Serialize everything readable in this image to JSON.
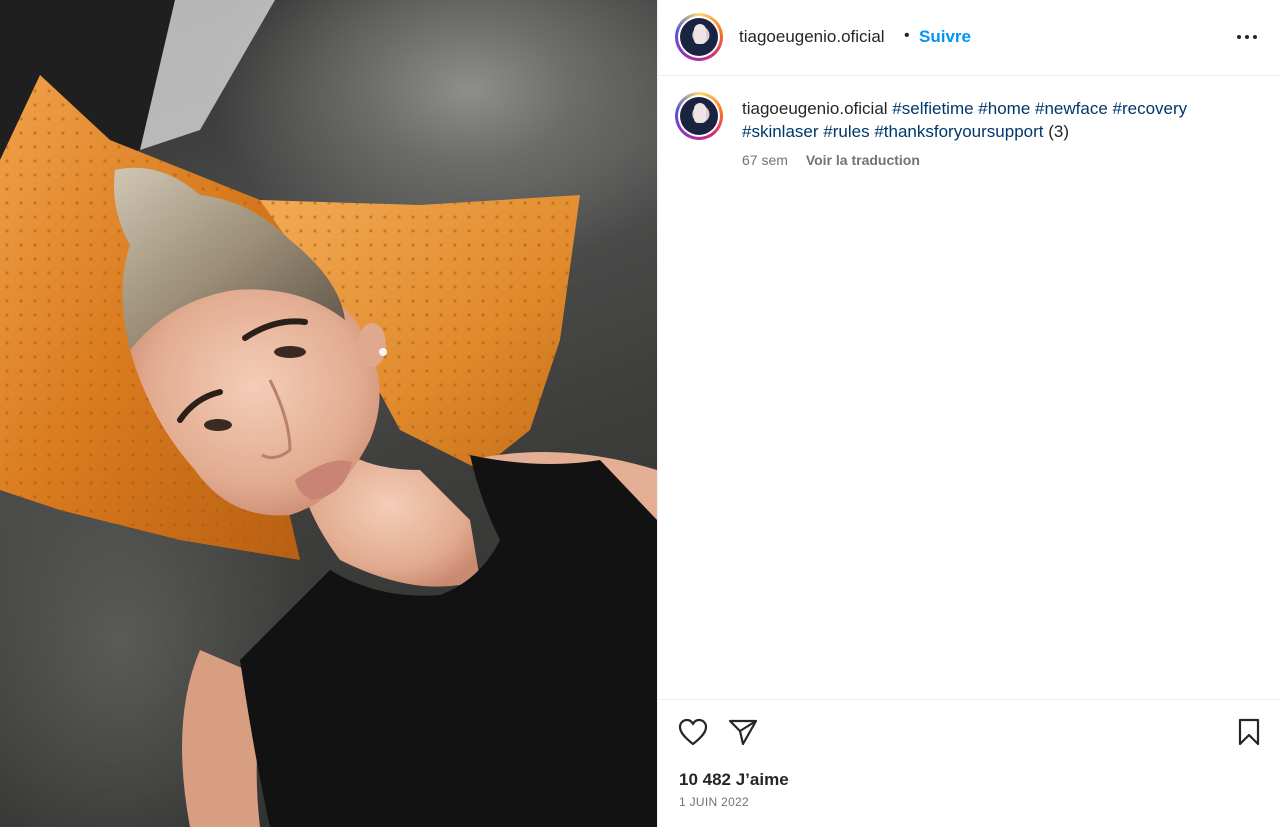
{
  "post": {
    "image_alt": "selfie",
    "header": {
      "username": "tiagoeugenio.oficial",
      "separator": "•",
      "follow_label": "Suivre",
      "more_icon": "more-horizontal-icon"
    },
    "caption": {
      "username": "tiagoeugenio.oficial",
      "hashtags_line1": [
        "#selfietime",
        "#home",
        "#newface",
        "#recovery"
      ],
      "hashtags_line2": [
        "#skinlaser",
        "#rules",
        "#thanksforyoursupport"
      ],
      "suffix": "(3)",
      "time_ago": "67 sem",
      "translate_label": "Voir la traduction"
    },
    "actions": {
      "like_icon": "heart-icon",
      "share_icon": "send-icon",
      "save_icon": "bookmark-icon"
    },
    "likes_text": "10 482 J’aime",
    "date": "1 JUIN 2022"
  },
  "colors": {
    "follow": "#0095f6",
    "hashtag": "#00376b",
    "muted": "#737373",
    "text": "#262626"
  }
}
